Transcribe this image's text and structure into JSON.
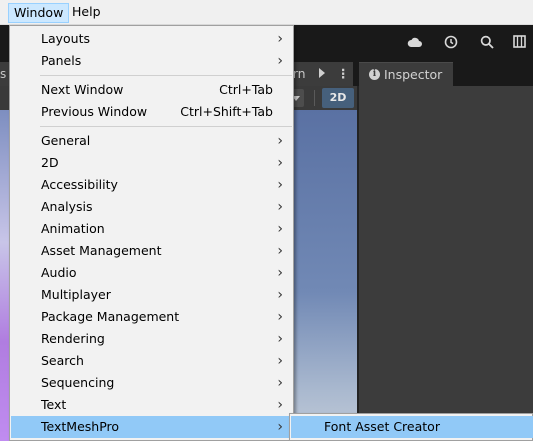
{
  "menubar": {
    "items": [
      {
        "label": "Window",
        "active": true
      },
      {
        "label": "Help",
        "active": false
      }
    ]
  },
  "toolbar": {
    "icons": [
      "cloud-icon",
      "history-icon",
      "search-icon",
      "layout-icon"
    ]
  },
  "tabs": {
    "left_fragment": "s",
    "scene_fragment": "ern",
    "inspector": "Inspector"
  },
  "scene_toolbar": {
    "mode_2d": "2D"
  },
  "window_menu": {
    "groups": [
      [
        {
          "label": "Layouts",
          "submenu": true
        },
        {
          "label": "Panels",
          "submenu": true
        }
      ],
      [
        {
          "label": "Next Window",
          "shortcut": "Ctrl+Tab"
        },
        {
          "label": "Previous Window",
          "shortcut": "Ctrl+Shift+Tab"
        }
      ],
      [
        {
          "label": "General",
          "submenu": true
        },
        {
          "label": "2D",
          "submenu": true
        },
        {
          "label": "Accessibility",
          "submenu": true
        },
        {
          "label": "Analysis",
          "submenu": true
        },
        {
          "label": "Animation",
          "submenu": true
        },
        {
          "label": "Asset Management",
          "submenu": true
        },
        {
          "label": "Audio",
          "submenu": true
        },
        {
          "label": "Multiplayer",
          "submenu": true
        },
        {
          "label": "Package Management",
          "submenu": true
        },
        {
          "label": "Rendering",
          "submenu": true
        },
        {
          "label": "Search",
          "submenu": true
        },
        {
          "label": "Sequencing",
          "submenu": true
        },
        {
          "label": "Text",
          "submenu": true
        },
        {
          "label": "TextMeshPro",
          "submenu": true,
          "highlighted": true
        }
      ]
    ]
  },
  "textmeshpro_submenu": {
    "items": [
      {
        "label": "Font Asset Creator",
        "highlighted": true
      }
    ]
  },
  "arrow_glyph": "›",
  "colors": {
    "menu_highlight": "#91c9f7",
    "menubar_active": "#cce8ff",
    "button_2d": "#46607c"
  }
}
